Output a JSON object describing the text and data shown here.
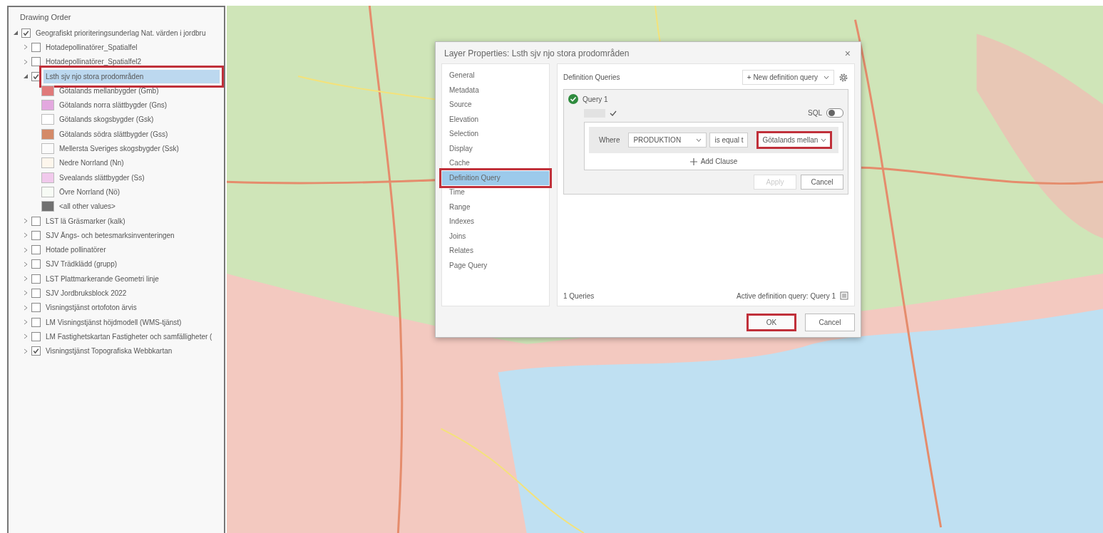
{
  "drawing_order": {
    "title": "Drawing Order",
    "tree": [
      {
        "kind": "layer",
        "label": "Geografiskt prioriteringsunderlag Nat. värden i jordbru",
        "checked": true,
        "expanded": true,
        "selected": false,
        "highlighted": false,
        "children": [
          {
            "kind": "layer",
            "label": "Hotadepollinatörer_Spatialfel",
            "checked": false,
            "expanded": false,
            "selected": false,
            "highlighted": false
          },
          {
            "kind": "layer",
            "label": "Hotadepollinatörer_Spatialfel2",
            "checked": false,
            "expanded": false,
            "selected": false,
            "highlighted": false
          },
          {
            "kind": "layer",
            "label": "Lsth sjv njo stora prodområden",
            "checked": true,
            "expanded": true,
            "selected": true,
            "highlighted": true,
            "children": [
              {
                "kind": "legend",
                "label": "Götalands mellanbygder (Gmb)",
                "color": "#e07a7a"
              },
              {
                "kind": "legend",
                "label": "Götalands norra slättbygder (Gns)",
                "color": "#e3a8df"
              },
              {
                "kind": "legend",
                "label": "Götalands skogsbygder (Gsk)",
                "color": "#ffffff"
              },
              {
                "kind": "legend",
                "label": "Götalands södra slättbygder (Gss)",
                "color": "#d48a68"
              },
              {
                "kind": "legend",
                "label": "Mellersta Sveriges skogsbygder (Ssk)",
                "color": "#fbfbfb"
              },
              {
                "kind": "legend",
                "label": "Nedre Norrland (Nn)",
                "color": "#fdf6ec"
              },
              {
                "kind": "legend",
                "label": "Svealands slättbygder (Ss)",
                "color": "#f1c9ec"
              },
              {
                "kind": "legend",
                "label": "Övre Norrland (Nö)",
                "color": "#f7fbf5"
              },
              {
                "kind": "legend",
                "label": "<all other values>",
                "color": "#707070"
              }
            ]
          },
          {
            "kind": "layer",
            "label": "LST lä Gräsmarker (kalk)",
            "checked": false,
            "expanded": false,
            "selected": false,
            "highlighted": false
          },
          {
            "kind": "layer",
            "label": "SJV Ängs- och betesmarksinventeringen",
            "checked": false,
            "expanded": false,
            "selected": false,
            "highlighted": false
          },
          {
            "kind": "layer",
            "label": "Hotade pollinatörer",
            "checked": false,
            "expanded": false,
            "selected": false,
            "highlighted": false
          },
          {
            "kind": "layer",
            "label": "SJV Trädklädd (grupp)",
            "checked": false,
            "expanded": false,
            "selected": false,
            "highlighted": false
          },
          {
            "kind": "layer",
            "label": "LST Plattmarkerande Geometri linje",
            "checked": false,
            "expanded": false,
            "selected": false,
            "highlighted": false
          },
          {
            "kind": "layer",
            "label": "SJV Jordbruksblock 2022",
            "checked": false,
            "expanded": false,
            "selected": false,
            "highlighted": false
          },
          {
            "kind": "layer",
            "label": "Visningstjänst ortofoton ärvis",
            "checked": false,
            "expanded": false,
            "selected": false,
            "highlighted": false
          },
          {
            "kind": "layer",
            "label": "LM Visningstjänst höjdmodell (WMS-tjänst)",
            "checked": false,
            "expanded": false,
            "selected": false,
            "highlighted": false
          },
          {
            "kind": "layer",
            "label": "LM Fastighetskartan Fastigheter och samfälligheter (",
            "checked": false,
            "expanded": false,
            "selected": false,
            "highlighted": false
          },
          {
            "kind": "layer",
            "label": "Visningstjänst Topografiska Webbkartan",
            "checked": true,
            "expanded": false,
            "selected": false,
            "highlighted": false
          }
        ]
      }
    ]
  },
  "dialog": {
    "title": "Layer Properties: Lsth sjv njo stora prodområden",
    "close": "×",
    "nav": [
      {
        "label": "General",
        "selected": false,
        "highlighted": false
      },
      {
        "label": "Metadata",
        "selected": false,
        "highlighted": false
      },
      {
        "label": "Source",
        "selected": false,
        "highlighted": false
      },
      {
        "label": "Elevation",
        "selected": false,
        "highlighted": false
      },
      {
        "label": "Selection",
        "selected": false,
        "highlighted": false
      },
      {
        "label": "Display",
        "selected": false,
        "highlighted": false
      },
      {
        "label": "Cache",
        "selected": false,
        "highlighted": false
      },
      {
        "label": "Definition Query",
        "selected": true,
        "highlighted": true
      },
      {
        "label": "Time",
        "selected": false,
        "highlighted": false
      },
      {
        "label": "Range",
        "selected": false,
        "highlighted": false
      },
      {
        "label": "Indexes",
        "selected": false,
        "highlighted": false
      },
      {
        "label": "Joins",
        "selected": false,
        "highlighted": false
      },
      {
        "label": "Relates",
        "selected": false,
        "highlighted": false
      },
      {
        "label": "Page Query",
        "selected": false,
        "highlighted": false
      }
    ],
    "section_title": "Definition Queries",
    "new_query": "+ New definition query",
    "query": {
      "name": "Query 1",
      "sql_label": "SQL",
      "sql_on": false,
      "clause": {
        "where": "Where",
        "field": "PRODUKTION",
        "operator": "is equal t",
        "value": "Götalands mellan",
        "value_highlighted": true
      },
      "add_clause": "Add Clause",
      "apply": "Apply",
      "apply_disabled": true,
      "cancel": "Cancel"
    },
    "query_count": "1 Queries",
    "active_query": "Active definition query: Query 1",
    "buttons": [
      {
        "label": "OK",
        "highlighted": true
      },
      {
        "label": "Cancel",
        "highlighted": false
      }
    ]
  }
}
